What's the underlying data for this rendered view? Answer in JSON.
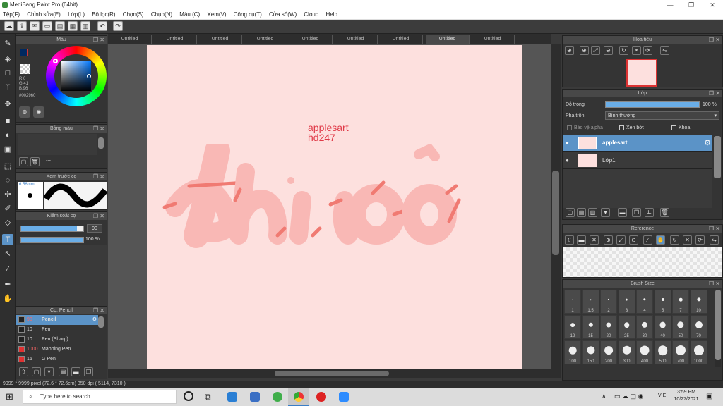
{
  "window": {
    "title": "MediBang Paint Pro (64bit)",
    "min": "—",
    "max": "❐",
    "close": "✕"
  },
  "menu": [
    "Tệp(F)",
    "Chỉnh sửa(E)",
    "Lớp(L)",
    "Bộ lọc(R)",
    "Chọn(S)",
    "Chụp(N)",
    "Màu (C)",
    "Xem(V)",
    "Công cụ(T)",
    "Cửa sổ(W)",
    "Cloud",
    "Help"
  ],
  "tabs": [
    "Untitled",
    "Untitled",
    "Untitled",
    "Untitled",
    "Untitled",
    "Untitled",
    "Untitled",
    "Untitled",
    "Untitled"
  ],
  "color_panel": {
    "title": "Màu",
    "r": "R:0",
    "g": "G:41",
    "b": "B:96",
    "hex": "#002960"
  },
  "palette_panel": {
    "title": "Bảng màu",
    "dash": "---"
  },
  "brush_preview": {
    "title": "Xem trước cọ",
    "size": "6.56mm"
  },
  "brush_control": {
    "title": "Kiểm soát cọ",
    "size_value": "90",
    "opacity_value": "100 %"
  },
  "brush_panel": {
    "title": "Cọ: Pencil",
    "items": [
      {
        "size": "90",
        "name": "Pencil",
        "color": "#222222"
      },
      {
        "size": "10",
        "name": "Pen",
        "color": "#222222"
      },
      {
        "size": "10",
        "name": "Pen (Sharp)",
        "color": "#222222"
      },
      {
        "size": "1000",
        "name": "Mapping Pen",
        "color": "#e03030"
      },
      {
        "size": "15",
        "name": "G Pen",
        "color": "#e03030"
      }
    ]
  },
  "canvas": {
    "watermark_line1": "applesart",
    "watermark_line2": "hd247",
    "art_text": "thi rồi"
  },
  "navigator": {
    "title": "Hoa tiêu"
  },
  "layer_panel": {
    "title": "Lớp",
    "opacity_label": "Độ trong",
    "opacity_value": "100 %",
    "blend_label": "Pha trộn",
    "blend_value": "Bình thường",
    "protect_alpha": "Bảo vệ alpha",
    "clipping": "Xén bớt",
    "lock": "Khóa",
    "layers": [
      {
        "name": "applesart"
      },
      {
        "name": "Lớp1"
      }
    ]
  },
  "reference_panel": {
    "title": "Reference"
  },
  "brush_size_panel": {
    "title": "Brush Size",
    "sizes": [
      "1",
      "1.5",
      "2",
      "3",
      "4",
      "5",
      "7",
      "10",
      "12",
      "15",
      "20",
      "25",
      "30",
      "40",
      "50",
      "70",
      "100",
      "150",
      "200",
      "300",
      "400",
      "500",
      "700",
      "1000"
    ]
  },
  "status": {
    "text": "9999 * 9999 pixel   (72.6 * 72.6cm)   350 dpi   ( 5114, 7310 )"
  },
  "taskbar": {
    "search_placeholder": "Type here to search",
    "time": "3:59 PM",
    "date": "10/27/2021",
    "lang": "VIE"
  },
  "colors": {
    "accent": "#5b93c7",
    "canvas": "#fde0de",
    "art": "#f6a7a5",
    "watermark": "#e03a48"
  }
}
